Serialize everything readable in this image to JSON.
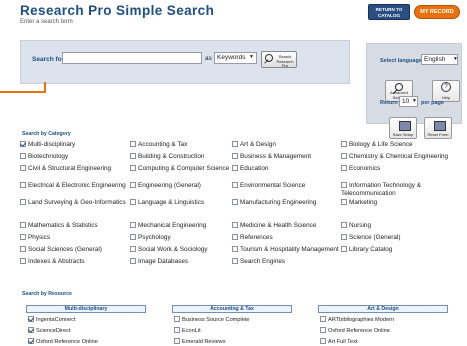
{
  "header": {
    "title": "Research Pro Simple Search",
    "subtitle": "Enter a search term",
    "return_to_catalog": "RETURN TO CATALOG",
    "my_record": "MY RECORD"
  },
  "search": {
    "label": "Search for:",
    "value": "",
    "as_label": "as",
    "type_value": "Keywords",
    "button_label": "Search Research Pro"
  },
  "options": {
    "language_label": "Select language:",
    "language_value": "English",
    "advanced_search_label": "Advanced Search",
    "help_label": "Help",
    "return_label": "Return",
    "return_value": "10",
    "per_page_label": "per page",
    "save_setup_label": "Save Setup",
    "reset_form_label": "Reset Form"
  },
  "categories": {
    "heading": "Search by Category",
    "items": [
      {
        "label": "Multi-disciplinary",
        "checked": true
      },
      {
        "label": "Accounting & Tax",
        "checked": false
      },
      {
        "label": "Art & Design",
        "checked": false
      },
      {
        "label": "Biology & Life Science",
        "checked": false
      },
      {
        "label": "Biotechnology",
        "checked": false
      },
      {
        "label": "Building & Construction",
        "checked": false
      },
      {
        "label": "Business & Management",
        "checked": false
      },
      {
        "label": "Chemistry & Chemical Engineering",
        "checked": false
      },
      {
        "label": "Civil & Structural Engineering",
        "checked": false
      },
      {
        "label": "Computing & Computer Science",
        "checked": false
      },
      {
        "label": "Education",
        "checked": false
      },
      {
        "label": "Economics",
        "checked": false
      },
      {
        "label": "Electrical & Electronic Engineering",
        "checked": false
      },
      {
        "label": "Engineering (General)",
        "checked": false
      },
      {
        "label": "Environmental Science",
        "checked": false
      },
      {
        "label": "Information Technology & Telecommunication",
        "checked": false
      },
      {
        "label": "Land Surveying & Geo-Informatics",
        "checked": false
      },
      {
        "label": "Language & Linguistics",
        "checked": false
      },
      {
        "label": "Manufacturing Engineering",
        "checked": false
      },
      {
        "label": "Marketing",
        "checked": false
      },
      {
        "label": "Mathematics & Statistics",
        "checked": false
      },
      {
        "label": "Mechanical Engineering",
        "checked": false
      },
      {
        "label": "Medicine & Health Science",
        "checked": false
      },
      {
        "label": "Nursing",
        "checked": false
      },
      {
        "label": "Physics",
        "checked": false
      },
      {
        "label": "Psychology",
        "checked": false
      },
      {
        "label": "References",
        "checked": false
      },
      {
        "label": "Science (General)",
        "checked": false
      },
      {
        "label": "Social Sciences (General)",
        "checked": false
      },
      {
        "label": "Social Work & Sociology",
        "checked": false
      },
      {
        "label": "Tourism & Hospitality Management",
        "checked": false
      },
      {
        "label": "Library Catalog",
        "checked": false
      },
      {
        "label": "Indexes & Abstracts",
        "checked": false
      },
      {
        "label": "Image Databases",
        "checked": false
      },
      {
        "label": "Search Engines",
        "checked": false
      }
    ]
  },
  "resources": {
    "heading": "Search by Resource",
    "groups": [
      {
        "title": "Multi-disciplinary",
        "items": [
          {
            "label": "IngentaConnect",
            "checked": true
          },
          {
            "label": "ScienceDirect",
            "checked": true
          },
          {
            "label": "Oxford Reference Online",
            "checked": true
          }
        ]
      },
      {
        "title": "Accounting & Tax",
        "items": [
          {
            "label": "Business Source Complete",
            "checked": false
          },
          {
            "label": "EconLit",
            "checked": false
          },
          {
            "label": "Emerald Reviews",
            "checked": false
          }
        ]
      },
      {
        "title": "Art & Design",
        "items": [
          {
            "label": "ARTbibliographies Modern",
            "checked": false
          },
          {
            "label": "Oxford Reference Online",
            "checked": false
          },
          {
            "label": "Art Full Text",
            "checked": false
          }
        ]
      }
    ]
  },
  "colors": {
    "accent": "#1d4e86",
    "brand_orange": "#e8730e"
  }
}
